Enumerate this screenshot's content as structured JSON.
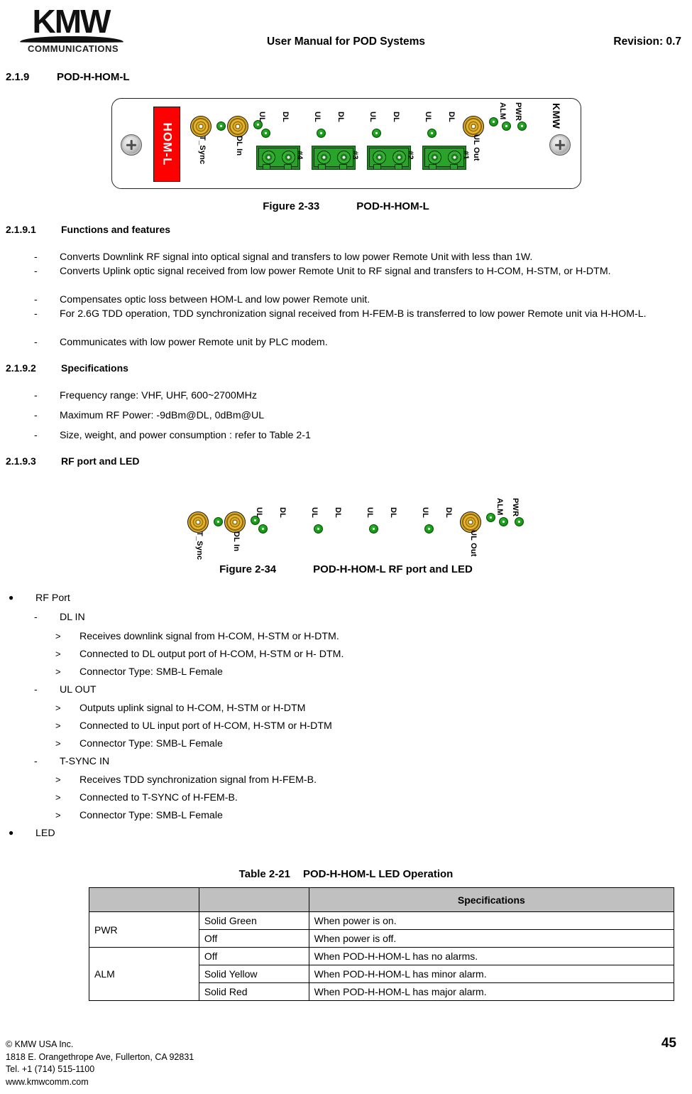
{
  "header": {
    "logo_text": "KMW",
    "logo_subtitle": "COMMUNICATIONS",
    "title": "User Manual for POD Systems",
    "revision": "Revision: 0.7"
  },
  "sections": {
    "s219_num": "2.1.9",
    "s219_title": "POD-H-HOM-L",
    "s2191_num": "2.1.9.1",
    "s2191_title": "Functions and features",
    "s2192_num": "2.1.9.2",
    "s2192_title": "Specifications",
    "s2193_num": "2.1.9.3",
    "s2193_title": "RF port and LED"
  },
  "functions": [
    "Converts Downlink RF signal into optical signal and transfers to low power Remote Unit with less than 1W.",
    "Converts Uplink optic signal received from low power Remote Unit to RF signal and transfers to H-COM, H-STM, or H-DTM.",
    "Compensates optic loss between HOM-L and low power Remote unit.",
    "For 2.6G TDD operation, TDD synchronization signal received from H-FEM-B is transferred to low power Remote unit via H-HOM-L.",
    "Communicates with low power Remote unit by PLC modem."
  ],
  "specifications": [
    "Frequency range: VHF, UHF, 600~2700MHz",
    "Maximum RF Power: -9dBm@DL, 0dBm@UL",
    "Size, weight, and power consumption : refer to Table 2-1"
  ],
  "figure33": {
    "label": "Figure 2-33",
    "title": "POD-H-HOM-L",
    "panel_label": "HOM-L",
    "brand_label": "KMW",
    "connectors": [
      {
        "name": "T_Sync",
        "type": "smb"
      },
      {
        "name": "DL In",
        "type": "smb"
      },
      {
        "name": "UL Out",
        "type": "smb"
      }
    ],
    "led_labels": [
      "UL",
      "DL",
      "ALM",
      "PWR"
    ],
    "optical_ports": [
      "#4",
      "#3",
      "#2",
      "#1"
    ]
  },
  "figure34": {
    "label": "Figure 2-34",
    "title": "POD-H-HOM-L RF port and LED",
    "connectors": [
      "T_Sync",
      "DL In",
      "UL Out"
    ],
    "led_labels": [
      "UL",
      "DL",
      "ALM",
      "PWR"
    ]
  },
  "rf_port": {
    "heading": "RF Port",
    "groups": [
      {
        "name": "DL IN",
        "details": [
          "Receives downlink signal from H-COM, H-STM or H-DTM.",
          "Connected to DL output port of H-COM, H-STM or H- DTM.",
          "Connector Type: SMB-L Female"
        ]
      },
      {
        "name": "UL OUT",
        "details": [
          "Outputs uplink signal to H-COM, H-STM or H-DTM",
          "Connected to UL input port of H-COM, H-STM or H-DTM",
          "Connector Type: SMB-L Female"
        ]
      },
      {
        "name": "T-SYNC IN",
        "details": [
          "Receives TDD synchronization signal from H-FEM-B.",
          "Connected to T-SYNC of H-FEM-B.",
          "Connector Type: SMB-L Female"
        ]
      }
    ],
    "led_heading": "LED"
  },
  "table": {
    "caption_label": "Table 2-21",
    "caption_title": "POD-H-HOM-L LED Operation",
    "headers": [
      "",
      "",
      "Specifications"
    ],
    "rows": [
      {
        "led": "PWR",
        "state": "Solid Green",
        "desc": "When power is on."
      },
      {
        "led": "",
        "state": "Off",
        "desc": "When power is off."
      },
      {
        "led": "ALM",
        "state": "Off",
        "desc": "When POD-H-HOM-L has no alarms."
      },
      {
        "led": "",
        "state": "Solid Yellow",
        "desc": "When POD-H-HOM-L has minor alarm."
      },
      {
        "led": "",
        "state": "Solid Red",
        "desc": "When POD-H-HOM-L has major alarm."
      }
    ]
  },
  "footer": {
    "line1": "© KMW USA Inc.",
    "line2": "1818 E. Orangethrope Ave, Fullerton, CA 92831",
    "line3": "Tel. +1 (714) 515-1100",
    "line4": "www.kmwcomm.com",
    "page": "45"
  },
  "colors": {
    "red_label": "#fe0000",
    "led_green": "#1aa01a",
    "connector_gold": "#d9a524",
    "optical_green": "#2aa32a",
    "table_header": "#c0c0c0"
  }
}
